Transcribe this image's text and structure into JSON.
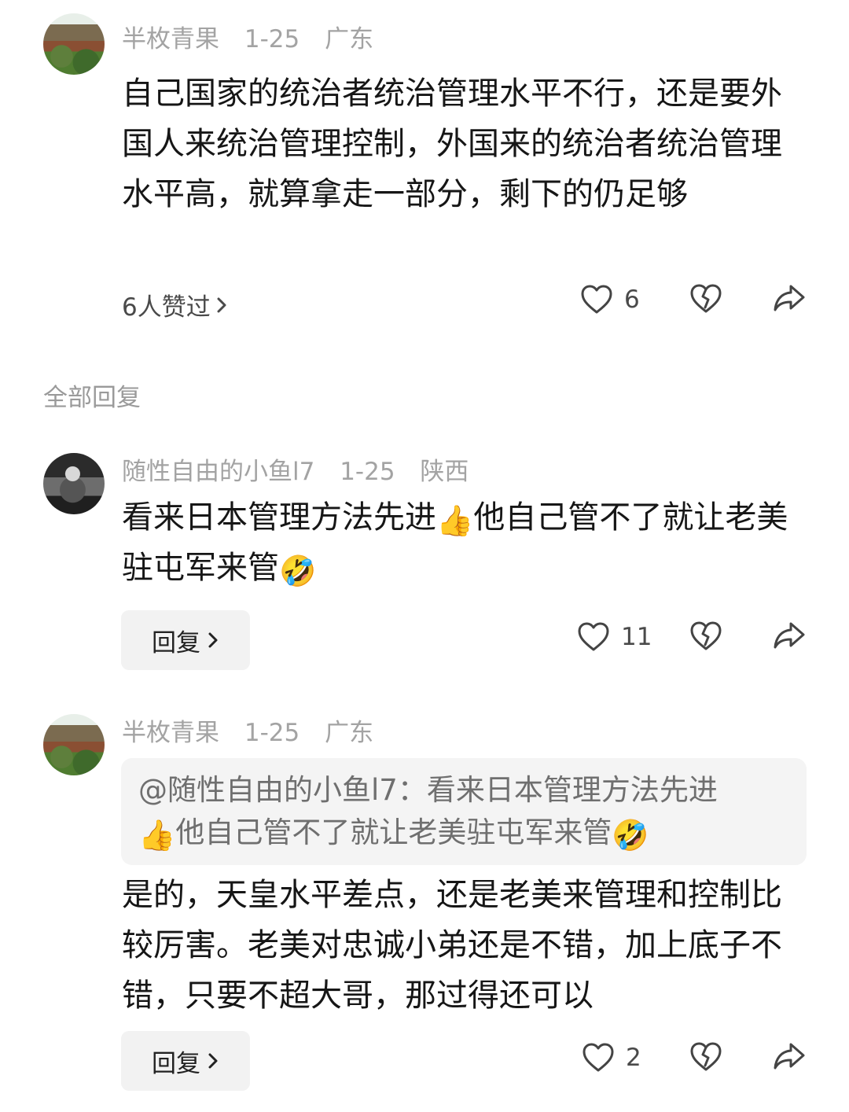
{
  "root_comment": {
    "username": "半枚青果",
    "date": "1-25",
    "location": "广东",
    "text": "自己国家的统治者统治管理水平不行，还是要外国人来统治管理控制，外国来的统治者统治管理水平高，就算拿走一部分，剩下的仍足够",
    "likers_text": "6人赞过",
    "like_count": "6"
  },
  "section_title": "全部回复",
  "replies": [
    {
      "username": "随性自由的小鱼l7",
      "date": "1-25",
      "location": "陕西",
      "text_part1": "看来日本管理方法先进",
      "emoji1": "👍",
      "text_part2": "他自己管不了就让老美驻屯军来管",
      "emoji2": "🤣",
      "reply_label": "回复",
      "like_count": "11"
    },
    {
      "username": "半枚青果",
      "date": "1-25",
      "location": "广东",
      "quote_part1": "@随性自由的小鱼l7：看来日本管理方法先进",
      "quote_emoji1": "👍",
      "quote_part2": "他自己管不了就让老美驻屯军来管",
      "quote_emoji2": "🤣",
      "text": "是的，天皇水平差点，还是老美来管理和控制比较厉害。老美对忠诚小弟还是不错，加上底子不错，只要不超大哥，那过得还可以",
      "reply_label": "回复",
      "like_count": "2"
    }
  ],
  "icons": {
    "like": "heart-outline-icon",
    "dislike": "broken-heart-icon",
    "share": "share-arrow-icon",
    "chevron": "chevron-right-icon"
  }
}
